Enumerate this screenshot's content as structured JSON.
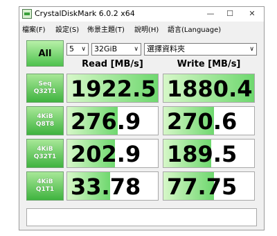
{
  "window": {
    "title": "CrystalDiskMark 6.0.2 x64",
    "buttons": {
      "minimize": "—",
      "maximize": "☐",
      "close": "✕"
    }
  },
  "menu": [
    "檔案(F)",
    "設定(S)",
    "佈景主題(T)",
    "說明(H)",
    "語言(Language)"
  ],
  "controls": {
    "all_label": "All",
    "count": "5",
    "size": "32GiB",
    "drive": "選擇資料夾"
  },
  "headers": {
    "read": "Read [MB/s]",
    "write": "Write [MB/s]"
  },
  "tests": [
    {
      "line1": "Seq",
      "line2": "Q32T1",
      "read": "1922.5",
      "write": "1880.4"
    },
    {
      "line1": "4KiB",
      "line2": "Q8T8",
      "read": "276.9",
      "write": "270.6"
    },
    {
      "line1": "4KiB",
      "line2": "Q32T1",
      "read": "202.9",
      "write": "189.5"
    },
    {
      "line1": "4KiB",
      "line2": "Q1T1",
      "read": "33.78",
      "write": "77.75"
    }
  ],
  "bar_fill_fraction": {
    "read": [
      1.0,
      0.56,
      0.53,
      0.47
    ],
    "write": [
      1.0,
      0.56,
      0.53,
      0.56
    ]
  },
  "colors": {
    "accent": "#4ec24e",
    "bar_light": "#d6f7c8"
  }
}
